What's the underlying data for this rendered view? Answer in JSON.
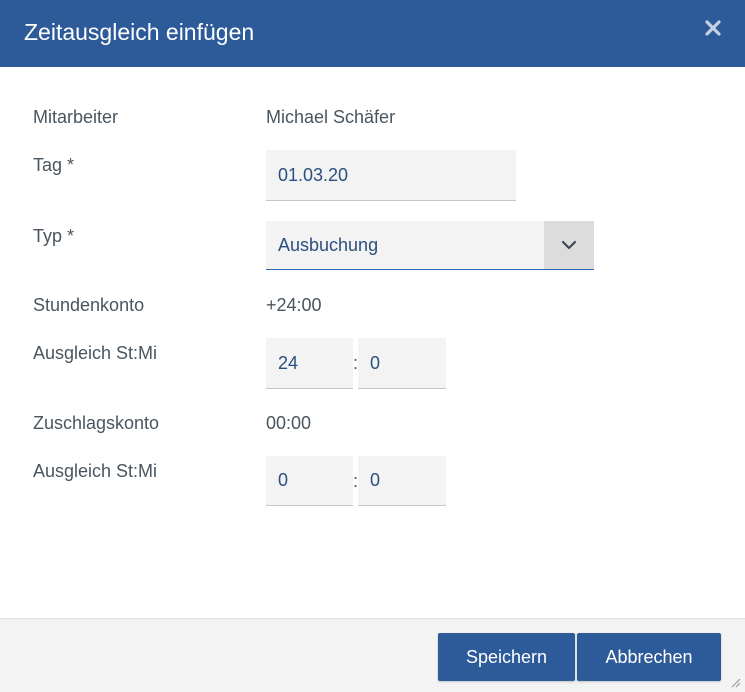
{
  "dialog": {
    "title": "Zeitausgleich einfügen",
    "close_icon": "close-icon",
    "accent_color": "#2d5a98"
  },
  "form": {
    "employee": {
      "label": "Mitarbeiter",
      "value": "Michael Schäfer"
    },
    "day": {
      "label": "Tag *",
      "value": "01.03.20"
    },
    "type": {
      "label": "Typ *",
      "selected": "Ausbuchung",
      "toggle_icon": "chevron-down-icon"
    },
    "hour_account": {
      "label": "Stundenkonto",
      "value": "+24:00"
    },
    "hour_compensation": {
      "label": "Ausgleich St:Mi",
      "hours": "24",
      "separator": ":",
      "minutes": "0"
    },
    "surcharge_account": {
      "label": "Zuschlagskonto",
      "value": "00:00"
    },
    "surcharge_compensation": {
      "label": "Ausgleich St:Mi",
      "hours": "0",
      "separator": ":",
      "minutes": "0"
    }
  },
  "footer": {
    "save_label": "Speichern",
    "cancel_label": "Abbrechen",
    "resize_icon": "resize-grip-icon"
  }
}
